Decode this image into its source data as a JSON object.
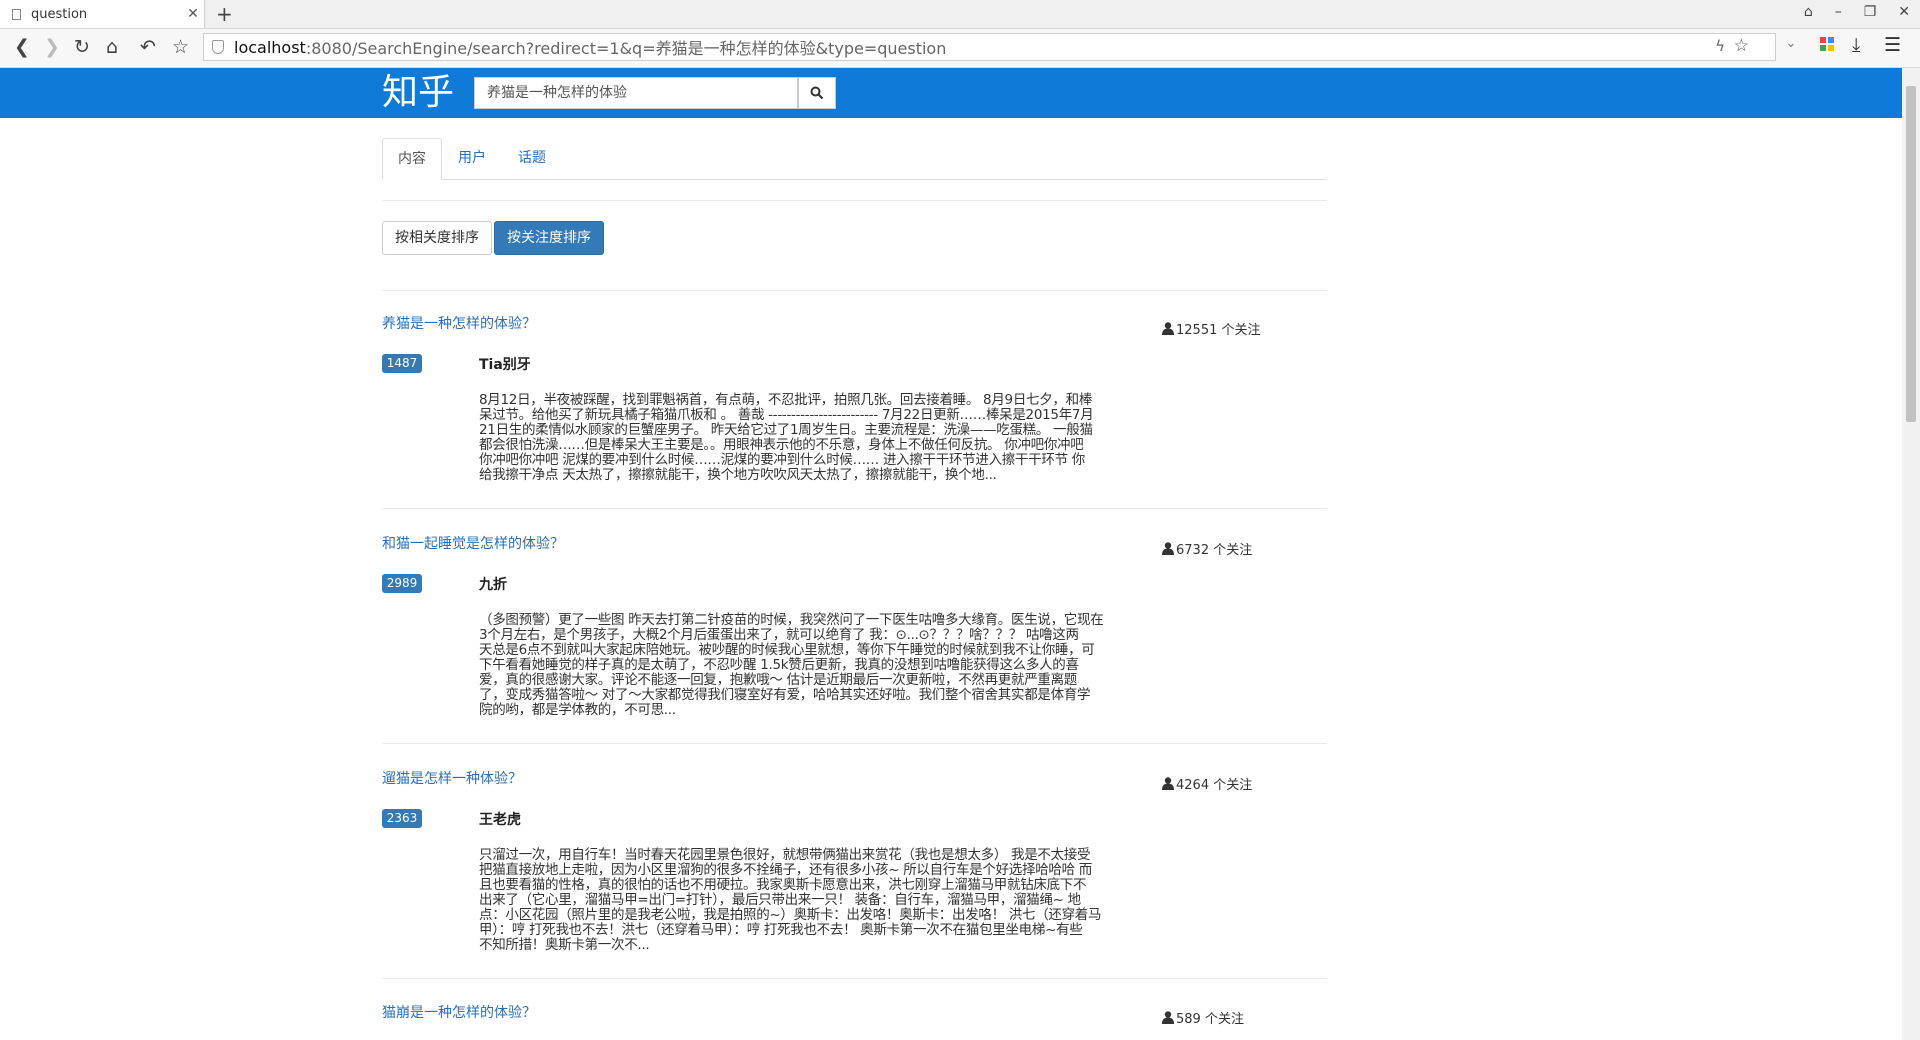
{
  "browser": {
    "tab_title": "question",
    "url_host": "localhost",
    "url_rest": ":8080/SearchEngine/search?redirect=1&q=养猫是一种怎样的体验&type=question"
  },
  "site": {
    "logo": "知乎",
    "search_value": "养猫是一种怎样的体验",
    "brand_color": "#0f7ad8"
  },
  "tabs": [
    "内容",
    "用户",
    "话题"
  ],
  "sort": {
    "relevance_label": "按相关度排序",
    "follow_label": "按关注度排序"
  },
  "results": [
    {
      "question": "养猫是一种怎样的体验？",
      "votes": "1487",
      "author": "Tia别牙",
      "followers": "12551 个关注",
      "lines": [
        "8月12日，半夜被踩醒，找到罪魁祸首，有点萌，不忍批评，拍照几张。回去接着睡。 8月9日七夕，和棒",
        "呆过节。给他买了新玩具橘子箱猫爪板和 。 善哉 ------------------------ 7月22日更新……棒呆是2015年7月",
        "21日生的柔情似水顾家的巨蟹座男子。 昨天给它过了1周岁生日。主要流程是：洗澡——吃蛋糕。 一般猫",
        "都会很怕洗澡……但是棒呆大王主要是。。用眼神表示他的不乐意，身体上不做任何反抗。 你冲吧你冲吧",
        "你冲吧你冲吧 泥煤的要冲到什么时候……泥煤的要冲到什么时候…… 进入擦干干环节进入擦干干环节 你",
        "给我擦干净点 天太热了，擦擦就能干，换个地方吹吹风天太热了，擦擦就能干，换个地..."
      ]
    },
    {
      "question": "和猫一起睡觉是怎样的体验？",
      "votes": "2989",
      "author": "九折",
      "followers": "6732 个关注",
      "lines": [
        "（多图预警）更了一些图 昨天去打第二针疫苗的时候，我突然问了一下医生咕噜多大缘育。医生说，它现在",
        "3个月左右，是个男孩子，大概2个月后蛋蛋出来了，就可以绝育了 我：⊙...⊙？？？啥？？？ 咕噜这两",
        "天总是6点不到就叫大家起床陪她玩。被吵醒的时候我心里就想，等你下午睡觉的时候就到我不让你睡，可",
        "下午看看她睡觉的样子真的是太萌了，不忍吵醒 1.5k赞后更新，我真的没想到咕噜能获得这么多人的喜",
        "爱，真的很感谢大家。评论不能逐一回复，抱歉哦～ 估计是近期最后一次更新啦，不然再更就严重离题",
        "了，变成秀猫答啦～ 对了～大家都觉得我们寝室好有爱，哈哈其实还好啦。我们整个宿舍其实都是体育学",
        "院的哟，都是学体教的，不可思..."
      ]
    },
    {
      "question": "遛猫是怎样一种体验？",
      "votes": "2363",
      "author": "王老虎",
      "followers": "4264 个关注",
      "lines": [
        "只溜过一次，用自行车！当时春天花园里景色很好，就想带俩猫出来赏花（我也是想太多） 我是不太接受",
        "把猫直接放地上走啦，因为小区里溜狗的很多不拴绳子，还有很多小孩~ 所以自行车是个好选择哈哈哈 而",
        "且也要看猫的性格，真的很怕的话也不用硬拉。我家奥斯卡愿意出来，洪七刚穿上溜猫马甲就钻床底下不",
        "出来了（它心里，溜猫马甲=出门=打针），最后只带出来一只！ 装备：自行车，溜猫马甲，溜猫绳~ 地",
        "点：小区花园（照片里的是我老公啦，我是拍照的~）奥斯卡：出发咯！奥斯卡：出发咯！ 洪七（还穿着马",
        "甲）：哼 打死我也不去！洪七（还穿着马甲）：哼 打死我也不去！ 奥斯卡第一次不在猫包里坐电梯~有些",
        "不知所措！奥斯卡第一次不..."
      ]
    },
    {
      "question": "猫崩是一种怎样的体验？",
      "votes": "",
      "author": "",
      "followers": "589 个关注",
      "lines": []
    }
  ]
}
